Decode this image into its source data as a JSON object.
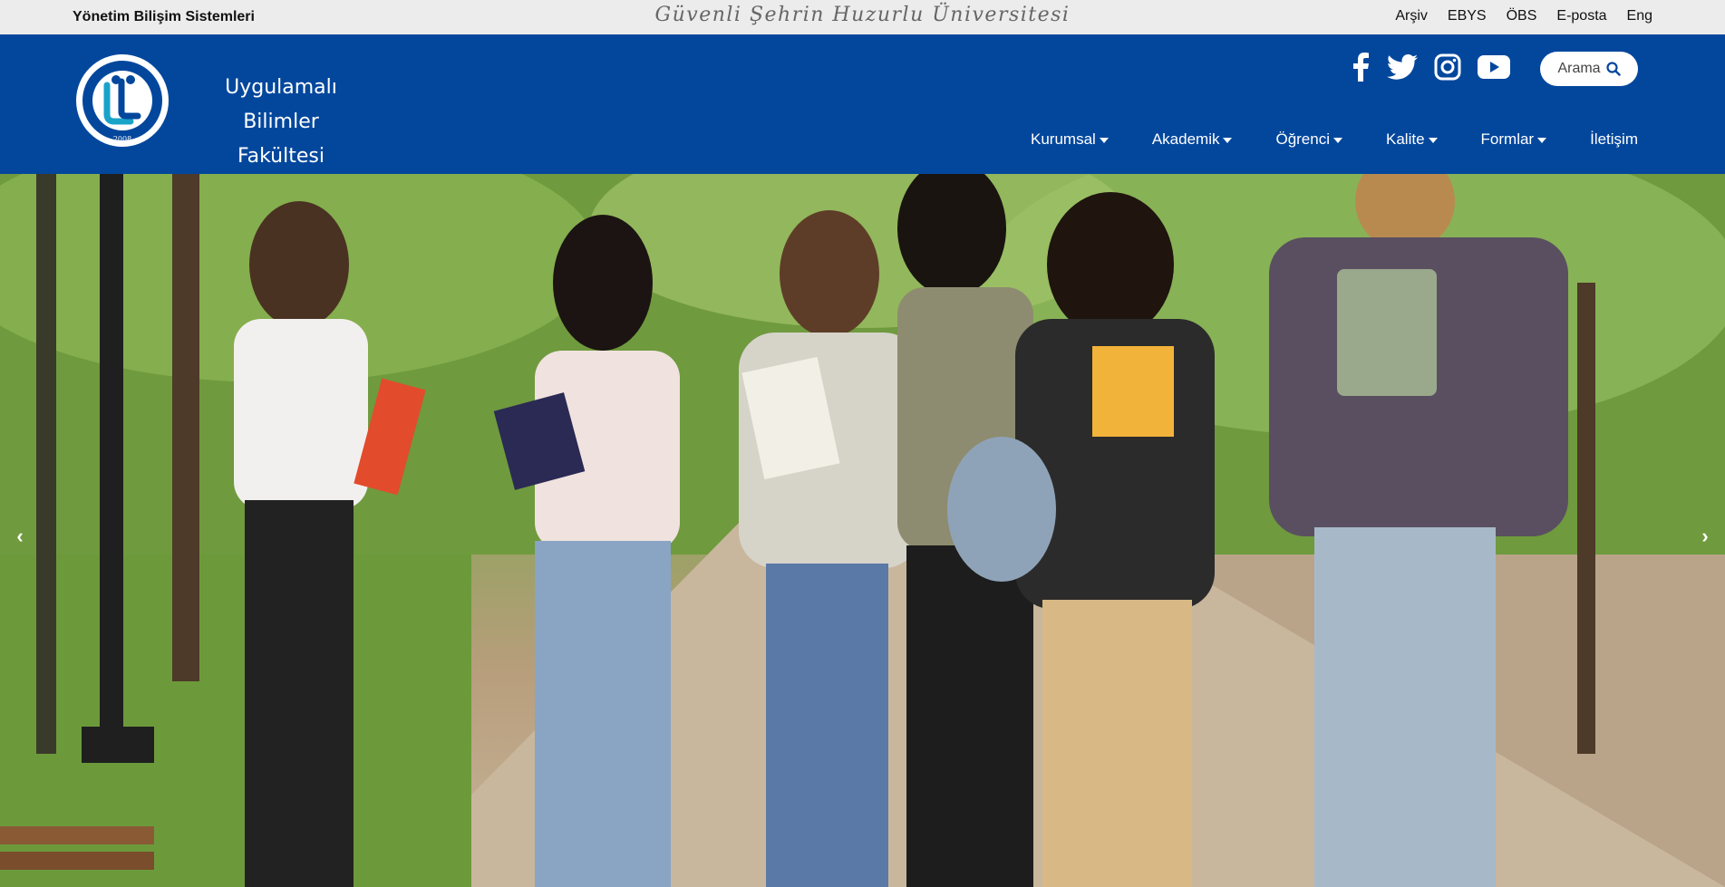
{
  "topbar": {
    "sys_title": "Yönetim Bilişim Sistemleri",
    "motto": "Güvenli Şehrin Huzurlu Üniversitesi",
    "links": [
      "Arşiv",
      "EBYS",
      "ÖBS",
      "E-posta",
      "Eng"
    ]
  },
  "header": {
    "faculty_line1": "Uygulamalı Bilimler",
    "faculty_line2": "Fakültesi",
    "logo_text": "BAYBURT ÜNİVERSİTESİ",
    "logo_year": "2008",
    "search_label": "Arama",
    "socials": [
      "facebook-icon",
      "twitter-icon",
      "instagram-icon",
      "youtube-icon"
    ]
  },
  "nav": {
    "items": [
      {
        "label": "Kurumsal",
        "dropdown": true
      },
      {
        "label": "Akademik",
        "dropdown": true
      },
      {
        "label": "Öğrenci",
        "dropdown": true
      },
      {
        "label": "Kalite",
        "dropdown": true
      },
      {
        "label": "Formlar",
        "dropdown": true
      },
      {
        "label": "İletişim",
        "dropdown": false
      }
    ]
  },
  "hero": {
    "prev": "‹",
    "next": "›"
  },
  "colors": {
    "header_blue": "#03479d",
    "topbar_gray": "#ececec"
  }
}
